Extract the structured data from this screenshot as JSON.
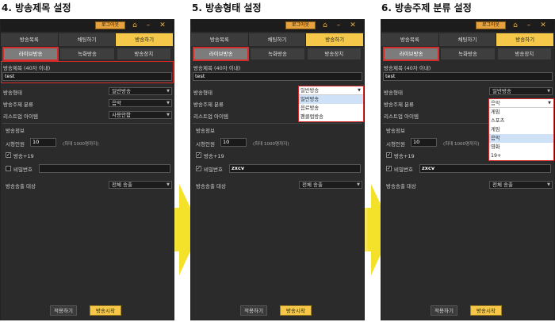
{
  "app": {
    "login_label": "로그아웃",
    "home_icon": "home-icon",
    "minimize_icon": "minimize-icon",
    "close_icon": "close-icon"
  },
  "tabs": {
    "broadcast_list": "방송목록",
    "chat": "채팅하기",
    "broadcast": "방송하기"
  },
  "subtabs": {
    "live": "라이브방송",
    "recorded": "녹화방송",
    "device": "방송장치"
  },
  "form": {
    "title_label": "방송제목 (40자 이내)",
    "title_value": "test",
    "type_label": "방송형태",
    "type_value": "일반방송",
    "topic_label": "방송주제 분류",
    "topic_value": "음악",
    "list_item_label": "리스트업 아이템",
    "list_item_value": "사용안함",
    "section_info": "방송정보",
    "viewers_label": "시청인원",
    "viewers_value": "10",
    "viewers_hint": "(최대 1000명까지)",
    "adult_label": "방송+19",
    "password_label": "비밀번호",
    "password_value": "zxcv",
    "audience_label": "방송송출 대상",
    "audience_value": "전체 송출",
    "apply_button": "적용하기",
    "start_button": "방송시작"
  },
  "steps": [
    {
      "title": "4. 방송제목 설정"
    },
    {
      "title": "5. 방송형태 설정"
    },
    {
      "title": "6. 방송주제 분류 설정"
    }
  ],
  "type_options": [
    "일반방송",
    "음료방송",
    "팬클럽방송"
  ],
  "topic_options": [
    "게임",
    "스포츠",
    "게임",
    "음악",
    "영화",
    "19+"
  ],
  "colors": {
    "accent": "#f5c84a",
    "highlight_border": "#d42a2a",
    "panel_bg": "#2b2b2b",
    "arrow": "#f3e12a"
  }
}
